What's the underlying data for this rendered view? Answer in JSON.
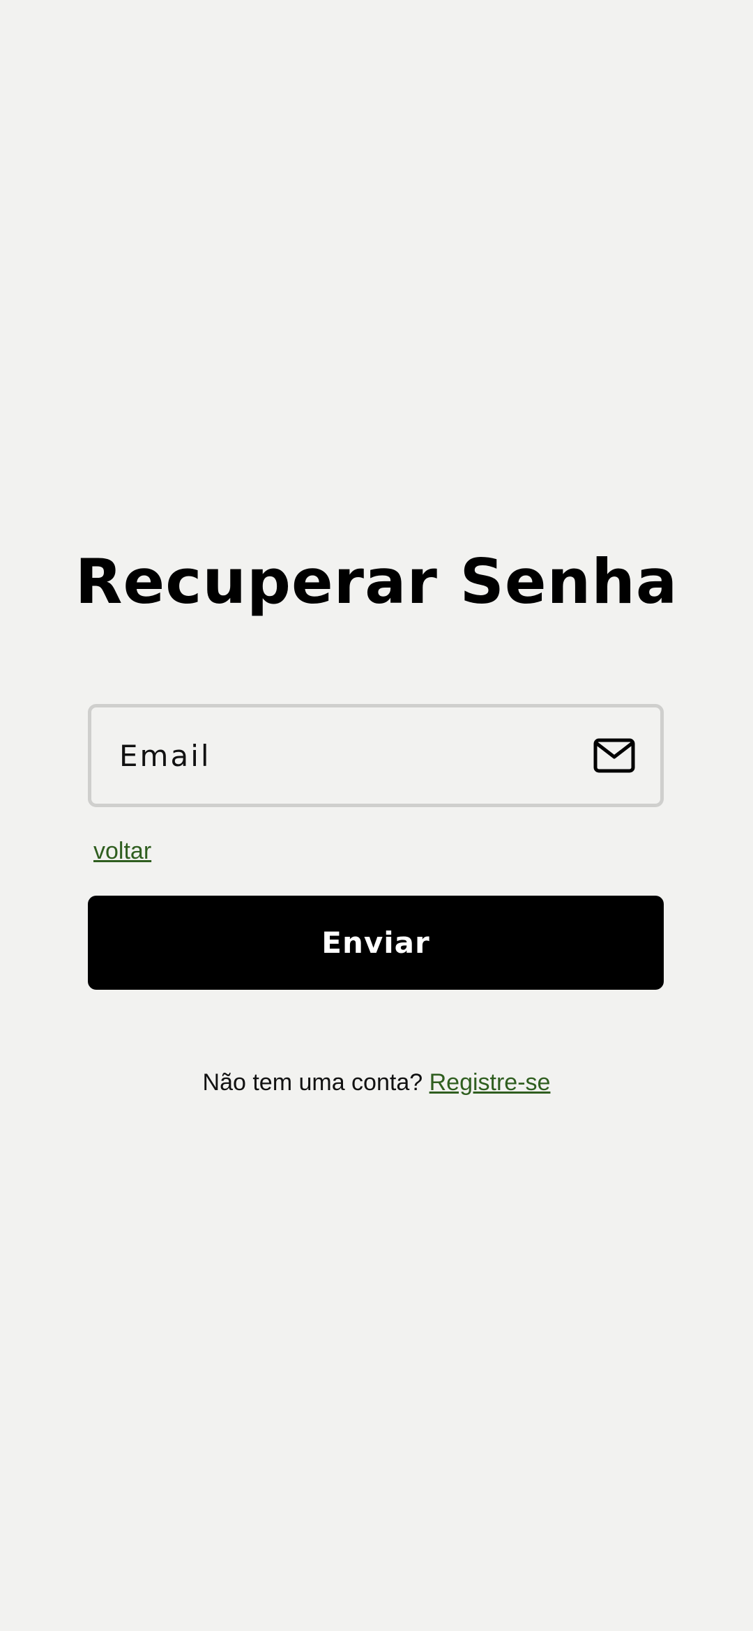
{
  "page": {
    "title": "Recuperar Senha"
  },
  "form": {
    "email_placeholder": "Email",
    "email_value": "",
    "email_icon": "mail-icon",
    "back_link": "voltar",
    "submit_label": "Enviar"
  },
  "footer": {
    "prompt": "Não tem uma conta?",
    "signup_link": "Registre-se"
  },
  "colors": {
    "background": "#f2f2f0",
    "button": "#000000",
    "link": "#2f5e1f",
    "field_border": "#cfcfcd"
  }
}
